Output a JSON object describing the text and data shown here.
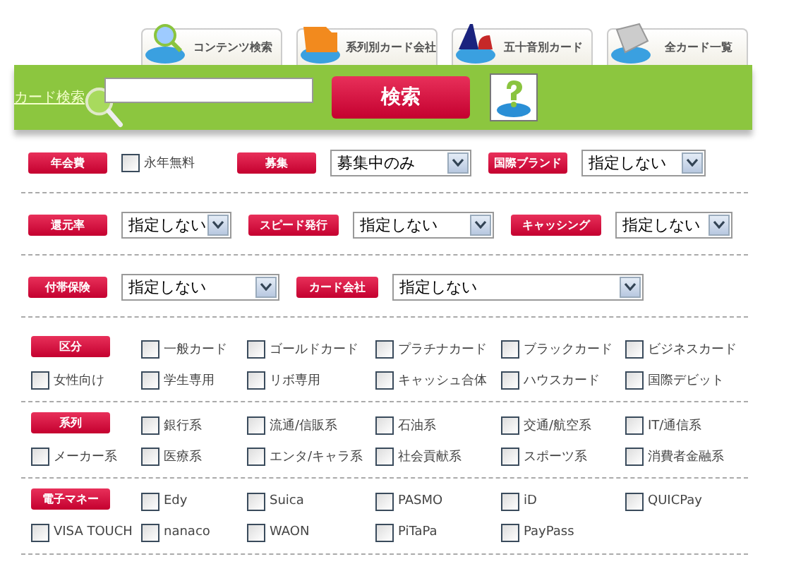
{
  "tabs": [
    {
      "label": "コンテンツ検索"
    },
    {
      "label": "系列別カード会社"
    },
    {
      "label": "五十音別カード"
    },
    {
      "label": "全カード一覧"
    }
  ],
  "search_bar": {
    "label": "カード検索",
    "button": "検索"
  },
  "filter_rows": [
    [
      {
        "label": "年会費",
        "kind": "checkbox",
        "option": "永年無料",
        "checked": false
      },
      {
        "label": "募集",
        "kind": "select",
        "value": "募集中のみ"
      },
      {
        "label": "国際ブランド",
        "kind": "select",
        "value": "指定しない"
      }
    ],
    [
      {
        "label": "還元率",
        "kind": "select",
        "value": "指定しない"
      },
      {
        "label": "スピード発行",
        "kind": "select",
        "value": "指定しない"
      },
      {
        "label": "キャッシング",
        "kind": "select",
        "value": "指定しない"
      }
    ],
    [
      {
        "label": "付帯保険",
        "kind": "select",
        "value": "指定しない"
      },
      {
        "label": "カード会社",
        "kind": "select",
        "value": "指定しない"
      }
    ]
  ],
  "checkbox_sections": [
    {
      "label": "区分",
      "options": [
        {
          "label": "一般カード",
          "checked": false
        },
        {
          "label": "ゴールドカード",
          "checked": false
        },
        {
          "label": "プラチナカード",
          "checked": false
        },
        {
          "label": "ブラックカード",
          "checked": false
        },
        {
          "label": "ビジネスカード",
          "checked": false
        },
        {
          "label": "女性向け",
          "checked": false
        },
        {
          "label": "学生専用",
          "checked": false
        },
        {
          "label": "リボ専用",
          "checked": false
        },
        {
          "label": "キャッシュ合体",
          "checked": false
        },
        {
          "label": "ハウスカード",
          "checked": false
        },
        {
          "label": "国際デビット",
          "checked": false
        }
      ]
    },
    {
      "label": "系列",
      "options": [
        {
          "label": "銀行系",
          "checked": false
        },
        {
          "label": "流通/信販系",
          "checked": false
        },
        {
          "label": "石油系",
          "checked": false
        },
        {
          "label": "交通/航空系",
          "checked": false
        },
        {
          "label": "IT/通信系",
          "checked": false
        },
        {
          "label": "メーカー系",
          "checked": false
        },
        {
          "label": "医療系",
          "checked": false
        },
        {
          "label": "エンタ/キャラ系",
          "checked": false
        },
        {
          "label": "社会貢献系",
          "checked": false
        },
        {
          "label": "スポーツ系",
          "checked": false
        },
        {
          "label": "消費者金融系",
          "checked": false
        }
      ]
    },
    {
      "label": "電子マネー",
      "options": [
        {
          "label": "Edy",
          "checked": false
        },
        {
          "label": "Suica",
          "checked": false
        },
        {
          "label": "PASMO",
          "checked": false
        },
        {
          "label": "iD",
          "checked": false
        },
        {
          "label": "QUICPay",
          "checked": false
        },
        {
          "label": "VISA TOUCH",
          "checked": false
        },
        {
          "label": "nanaco",
          "checked": false
        },
        {
          "label": "WAON",
          "checked": false
        },
        {
          "label": "PiTaPa",
          "checked": false
        },
        {
          "label": "PayPass",
          "checked": false
        }
      ]
    }
  ]
}
